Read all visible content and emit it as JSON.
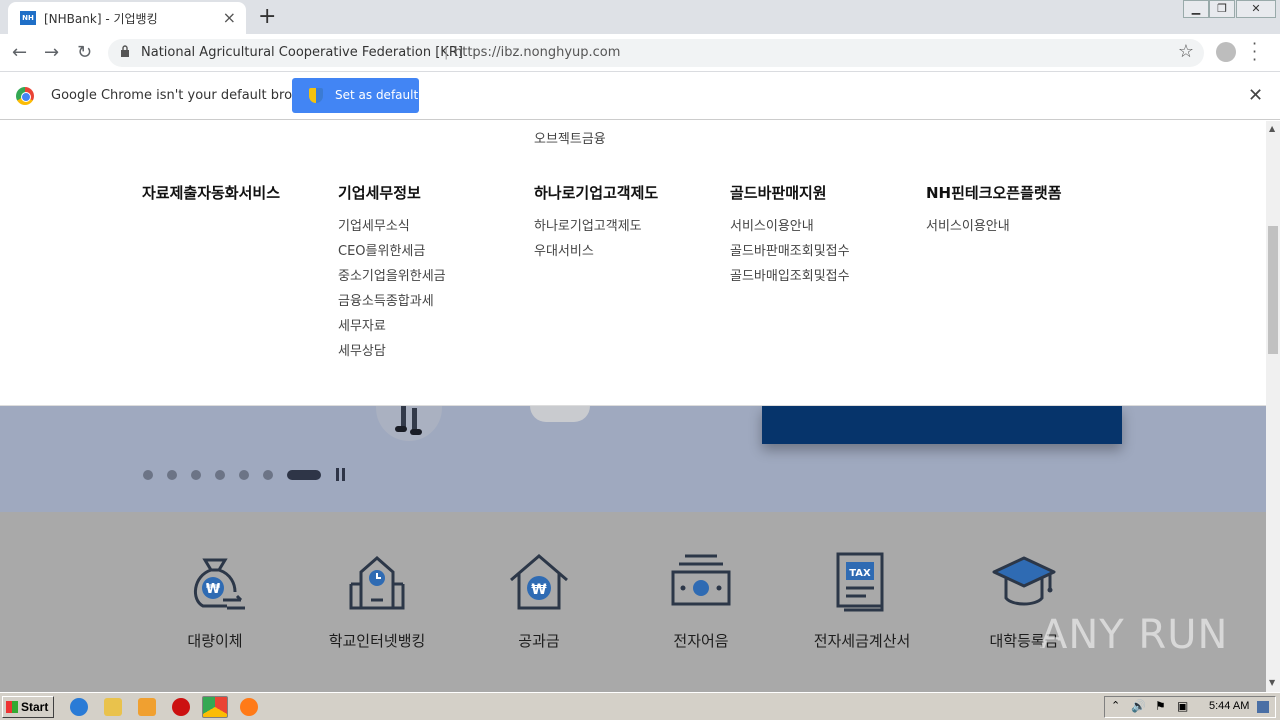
{
  "browser": {
    "tab_title": "[NHBank] - 기업뱅킹",
    "tab_favicon": "NH",
    "security_org": "National Agricultural Cooperative Federation [KR]",
    "url": "https://ibz.nonghyup.com"
  },
  "infobar": {
    "message": "Google Chrome isn't your default browser",
    "button": "Set as default"
  },
  "mega_menu": {
    "top_item": "오브젝트금융",
    "columns": [
      {
        "heading": "자료제출자동화서비스",
        "items": []
      },
      {
        "heading": "기업세무정보",
        "items": [
          "기업세무소식",
          "CEO를위한세금",
          "중소기업을위한세금",
          "금융소득종합과세",
          "세무자료",
          "세무상담"
        ]
      },
      {
        "heading": "하나로기업고객제도",
        "items": [
          "하나로기업고객제도",
          "우대서비스"
        ]
      },
      {
        "heading": "골드바판매지원",
        "items": [
          "서비스이용안내",
          "골드바판매조회및접수",
          "골드바매입조회및접수"
        ]
      },
      {
        "heading": "NH핀테크오픈플랫폼",
        "items": [
          "서비스이용안내"
        ]
      }
    ]
  },
  "carousel": {
    "slide_count": 7,
    "active_index": 6
  },
  "services": [
    {
      "label": "대량이체",
      "icon": "money-bag-transfer-icon"
    },
    {
      "label": "학교인터넷뱅킹",
      "icon": "school-clock-icon"
    },
    {
      "label": "공과금",
      "icon": "house-won-icon"
    },
    {
      "label": "전자어음",
      "icon": "banknote-icon"
    },
    {
      "label": "전자세금계산서",
      "icon": "tax-document-icon"
    },
    {
      "label": "대학등록금",
      "icon": "graduation-cap-icon"
    }
  ],
  "watermark": "ANY RUN",
  "taskbar": {
    "start": "Start",
    "clock": "5:44 AM"
  },
  "colors": {
    "brand_navy": "#06346b",
    "icon_navy": "#2c3748",
    "icon_blue": "#2f6bb3",
    "chrome_blue": "#4285f4"
  }
}
